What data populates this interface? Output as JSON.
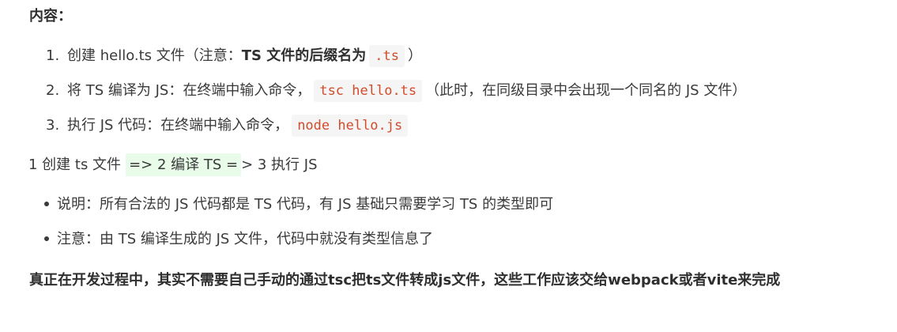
{
  "heading": "内容：",
  "steps": [
    {
      "num": "1.",
      "text1": "创建 hello.ts 文件（注意：",
      "bold": "TS 文件的后缀名为",
      "code": ".ts",
      "text2": "）"
    },
    {
      "num": "2.",
      "text1": "将 TS 编译为 JS：在终端中输入命令，",
      "code": "tsc hello.ts",
      "text2": "（此时，在同级目录中会出现一个同名的 JS 文件）"
    },
    {
      "num": "3.",
      "text1": "执行 JS 代码：在终端中输入命令，",
      "code": "node hello.js"
    }
  ],
  "flow": {
    "prefix": "1 创建 ts 文件",
    "highlight": "=> 2 编译 TS =",
    "suffix": "> 3 执行 JS"
  },
  "bullets": [
    "说明：所有合法的 JS 代码都是 TS 代码，有 JS 基础只需要学习 TS 的类型即可",
    "注意：由 TS 编译生成的 JS 文件，代码中就没有类型信息了"
  ],
  "final": "真正在开发过程中，其实不需要自己手动的通过tsc把ts文件转成js文件，这些工作应该交给webpack或者vite来完成"
}
